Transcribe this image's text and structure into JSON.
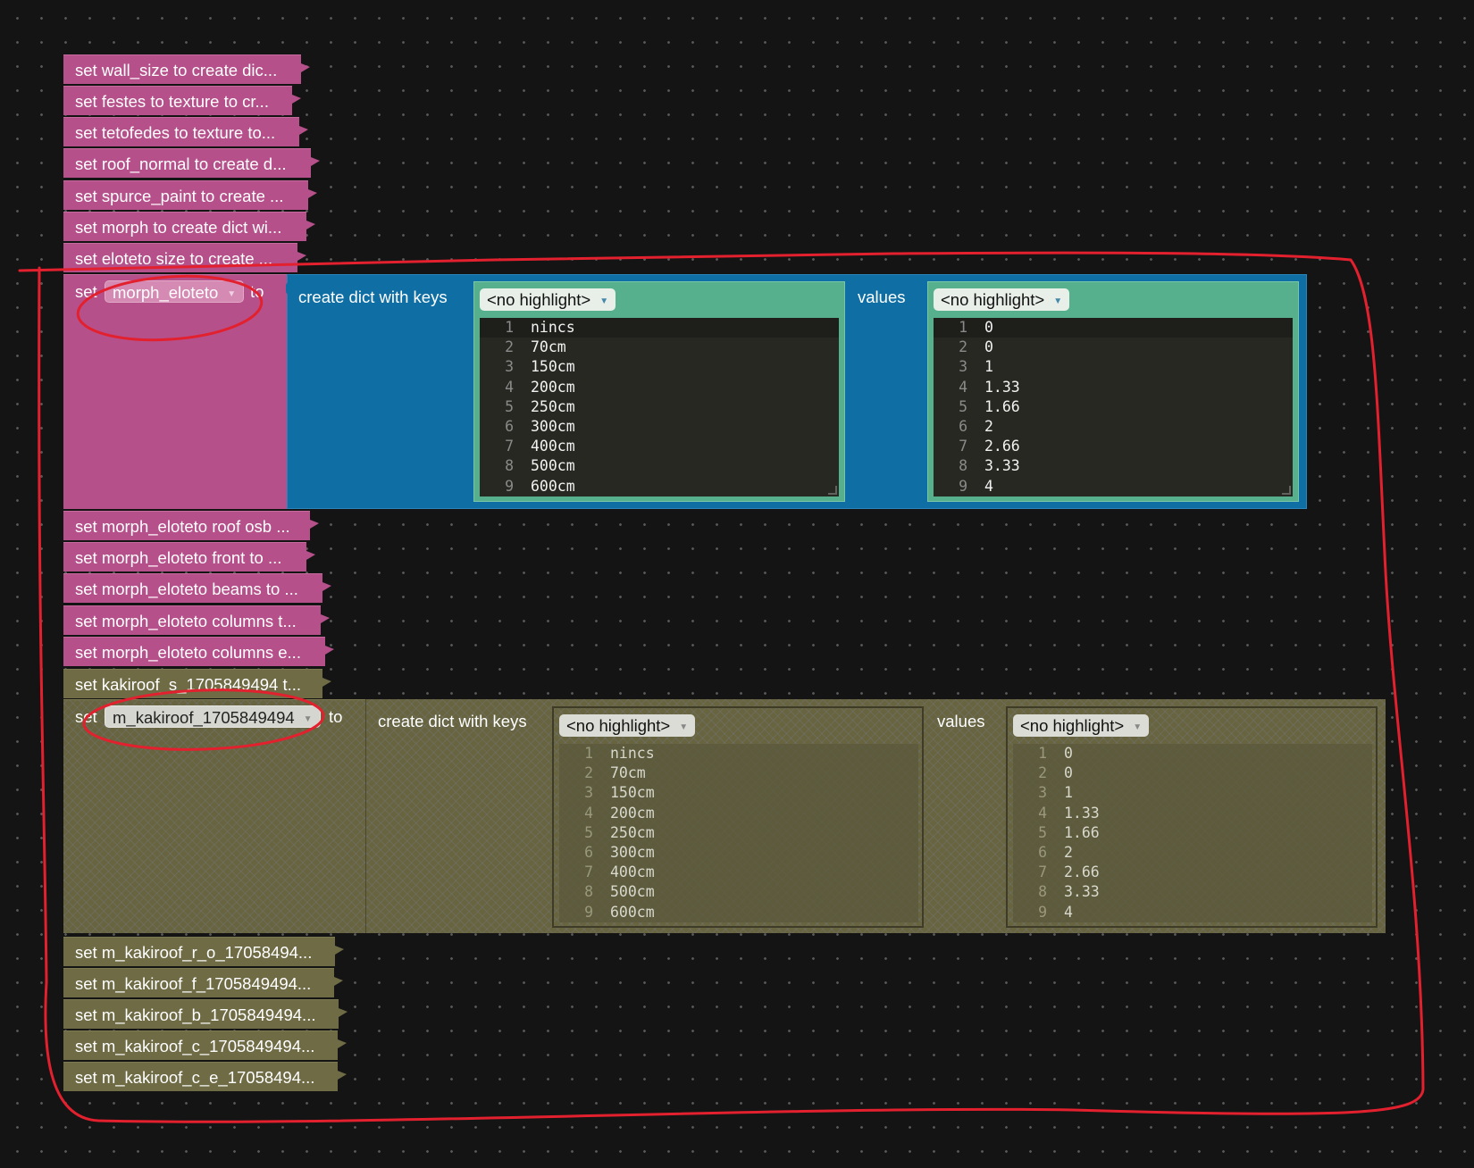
{
  "top_blocks": [
    "set wall_size to create dic...",
    "set festes to texture to cr...",
    "set tetofedes to texture to...",
    "set roof_normal to create d...",
    "set spurce_paint to create ...",
    "set morph to create dict wi...",
    "set eloteto size to create ..."
  ],
  "main_block": {
    "set_label": "set",
    "variable": "morph_eloteto",
    "to_label": "to",
    "create_label": "create dict with keys",
    "values_label": "values",
    "keys_highlight": "<no highlight>",
    "values_highlight": "<no highlight>",
    "keys": [
      "nincs",
      "70cm",
      "150cm",
      "200cm",
      "250cm",
      "300cm",
      "400cm",
      "500cm",
      "600cm"
    ],
    "values": [
      "0",
      "0",
      "1",
      "1.33",
      "1.66",
      "2",
      "2.66",
      "3.33",
      "4"
    ],
    "line_numbers": [
      "1",
      "2",
      "3",
      "4",
      "5",
      "6",
      "7",
      "8",
      "9"
    ]
  },
  "middle_blocks": [
    "set morph_eloteto roof osb ...",
    "set morph_eloteto front to ...",
    "set morph_eloteto beams to ...",
    "set morph_eloteto columns t...",
    "set morph_eloteto columns e..."
  ],
  "olive_block_top": "set kakiroof_s_1705849494 t...",
  "disabled_block": {
    "set_label": "set",
    "variable": "m_kakiroof_1705849494",
    "to_label": "to",
    "create_label": "create dict with keys",
    "values_label": "values",
    "keys_highlight": "<no highlight>",
    "values_highlight": "<no highlight>",
    "keys": [
      "nincs",
      "70cm",
      "150cm",
      "200cm",
      "250cm",
      "300cm",
      "400cm",
      "500cm",
      "600cm"
    ],
    "values": [
      "0",
      "0",
      "1",
      "1.33",
      "1.66",
      "2",
      "2.66",
      "3.33",
      "4"
    ],
    "line_numbers": [
      "1",
      "2",
      "3",
      "4",
      "5",
      "6",
      "7",
      "8",
      "9"
    ]
  },
  "bottom_blocks": [
    "set m_kakiroof_r_o_17058494...",
    "set m_kakiroof_f_1705849494...",
    "set m_kakiroof_b_1705849494...",
    "set m_kakiroof_c_1705849494...",
    "set m_kakiroof_c_e_17058494..."
  ],
  "colors": {
    "workspace": "#141414",
    "pink_block": "#b5508a",
    "blue_block": "#0f6fa5",
    "green_block": "#56b08e",
    "editor_bg": "#272822",
    "olive_block": "#6e6b45",
    "annotation_red": "#e3202e"
  }
}
